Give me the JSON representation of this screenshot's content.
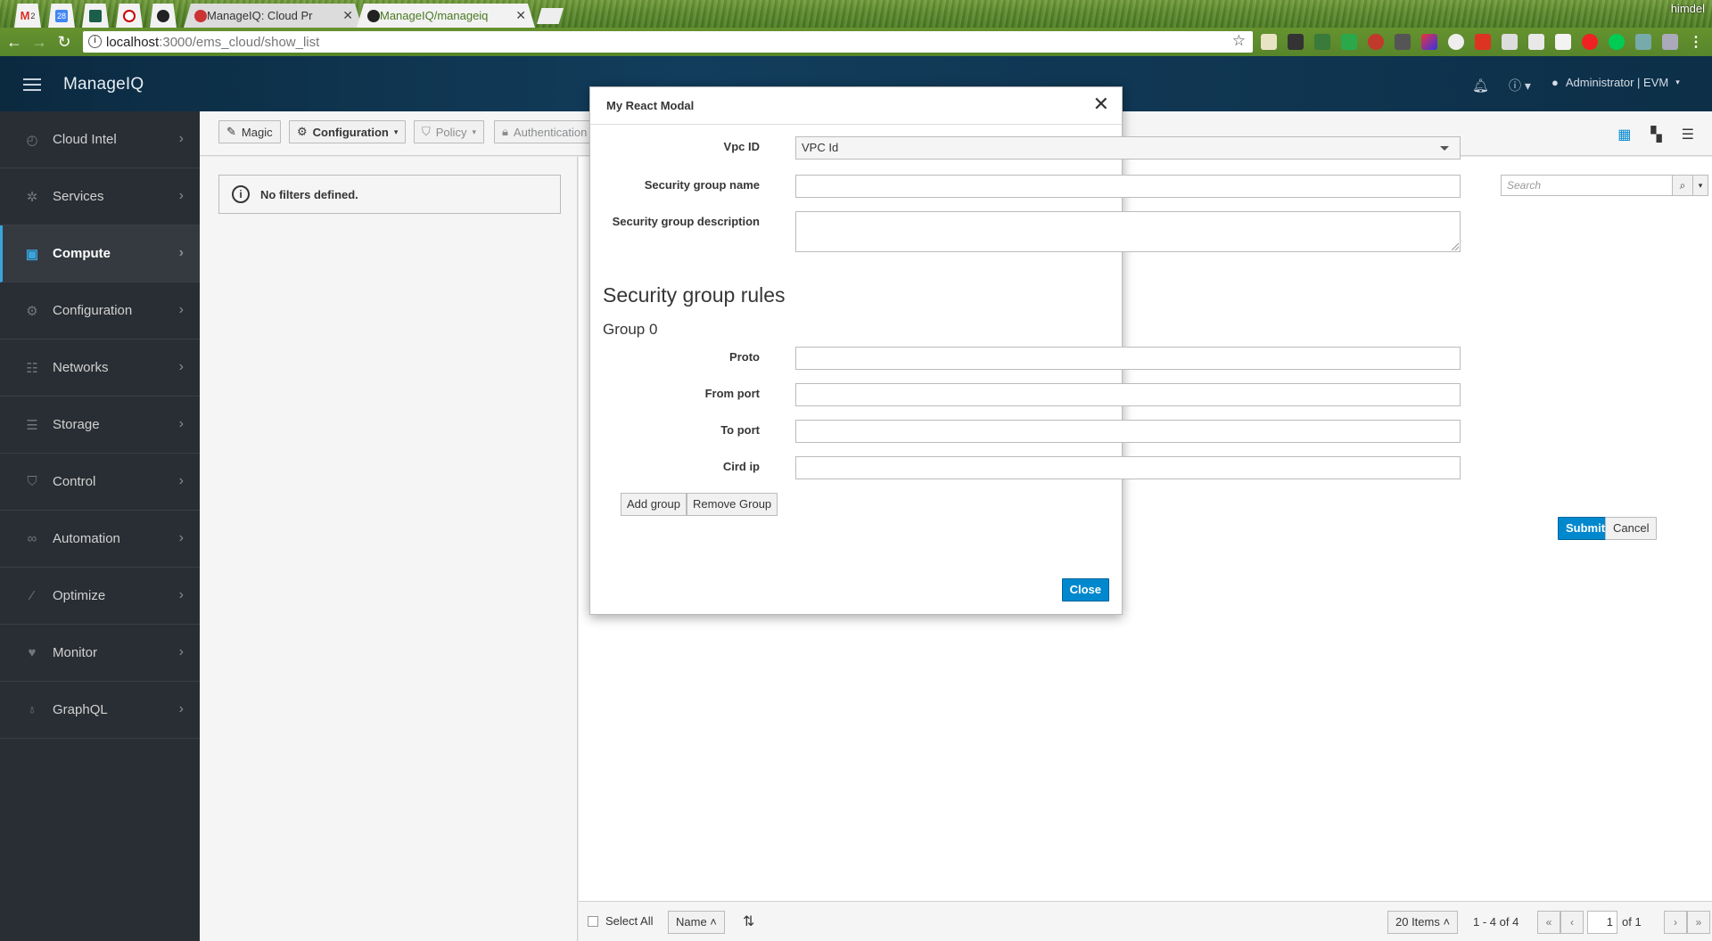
{
  "browser": {
    "tabs": [
      {
        "title": "ManageIQ: Cloud Pr",
        "active": false
      },
      {
        "title": "ManageIQ/manageiq",
        "active": true
      }
    ],
    "pinned_badge": "2",
    "calendar_badge": "28",
    "profile_name": "himdel",
    "url_host": "localhost",
    "url_path": ":3000/ems_cloud/show_list"
  },
  "app": {
    "brand": "ManageIQ",
    "user": "Administrator | EVM"
  },
  "sidebar": {
    "items": [
      {
        "label": "Cloud Intel",
        "icon": "dashboard-icon"
      },
      {
        "label": "Services",
        "icon": "services-icon"
      },
      {
        "label": "Compute",
        "icon": "cpu-icon",
        "active": true
      },
      {
        "label": "Configuration",
        "icon": "gear-icon"
      },
      {
        "label": "Networks",
        "icon": "network-icon"
      },
      {
        "label": "Storage",
        "icon": "database-icon"
      },
      {
        "label": "Control",
        "icon": "shield-icon"
      },
      {
        "label": "Automation",
        "icon": "infinity-icon"
      },
      {
        "label": "Optimize",
        "icon": "wand-icon"
      },
      {
        "label": "Monitor",
        "icon": "heartbeat-icon"
      },
      {
        "label": "GraphQL",
        "icon": "lightbulb-icon"
      }
    ]
  },
  "toolbar": {
    "magic": "Magic",
    "configuration": "Configuration",
    "policy": "Policy",
    "authentication": "Authentication"
  },
  "main": {
    "filter_message": "No filters defined.",
    "search_placeholder": "Search",
    "submit": "Submit",
    "cancel": "Cancel"
  },
  "footer": {
    "select_all": "Select All",
    "sort": "Name",
    "per_page": "20 Items",
    "range": "1 - 4 of 4",
    "page": "1",
    "of_pages": "of 1"
  },
  "modal": {
    "title": "My React Modal",
    "vpc_label": "Vpc ID",
    "vpc_value": "VPC Id",
    "sg_name_label": "Security group name",
    "sg_desc_label": "Security group description",
    "rules_title": "Security group rules",
    "group_title": "Group 0",
    "proto_label": "Proto",
    "from_port_label": "From port",
    "to_port_label": "To port",
    "cidr_label": "Cird ip",
    "add_group": "Add group",
    "remove_group": "Remove Group",
    "close": "Close"
  },
  "colors": {
    "accent": "#0088ce",
    "sidebar_bg": "#292e34",
    "header_bg": "#0b2a40"
  }
}
